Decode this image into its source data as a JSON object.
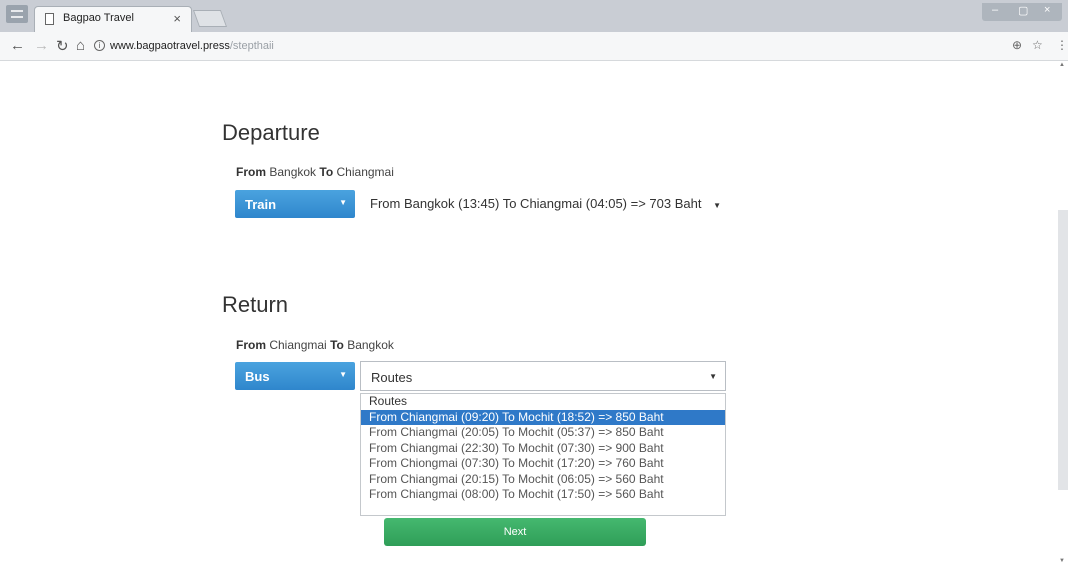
{
  "browser": {
    "tab_title": "Bagpao Travel",
    "tab_close": "×",
    "url_host": "www.bagpaotravel.press",
    "url_path": "/stepthaii",
    "icons": [
      "menu-icon",
      "page-icon",
      "back-icon",
      "forward-icon",
      "reload-icon",
      "home-icon",
      "info-icon",
      "zoom-icon",
      "star-icon",
      "more-icon"
    ]
  },
  "departure": {
    "title": "Departure",
    "from_label": "From",
    "from_value": "Bangkok",
    "to_label": "To",
    "to_value": "Chiangmai",
    "mode": "Train",
    "route": "From Bangkok (13:45) To Chiangmai (04:05) => 703 Baht"
  },
  "return": {
    "title": "Return",
    "from_label": "From",
    "from_value": "Chiangmai",
    "to_label": "To",
    "to_value": "Bangkok",
    "mode": "Bus",
    "selected_route": "Routes",
    "options": [
      "Routes",
      "From Chiangmai (09:20) To Mochit (18:52) => 850 Baht",
      "From Chiangmai (20:05) To Mochit (05:37) => 850 Baht",
      "From Chiangmai (22:30) To Mochit (07:30) => 900 Baht",
      "From Chiongmai (07:30) To Mochit (17:20) => 760 Baht",
      "From Chiangmai (20:15) To Mochit (06:05) => 560 Baht",
      "From Chiangmai (08:00) To Mochit (17:50) => 560 Baht"
    ],
    "highlighted_index": 1
  },
  "next_button": "Next",
  "colors": {
    "select_blue": "#2f86cc",
    "highlight_blue": "#2f79c8",
    "next_green": "#2f9e58"
  }
}
